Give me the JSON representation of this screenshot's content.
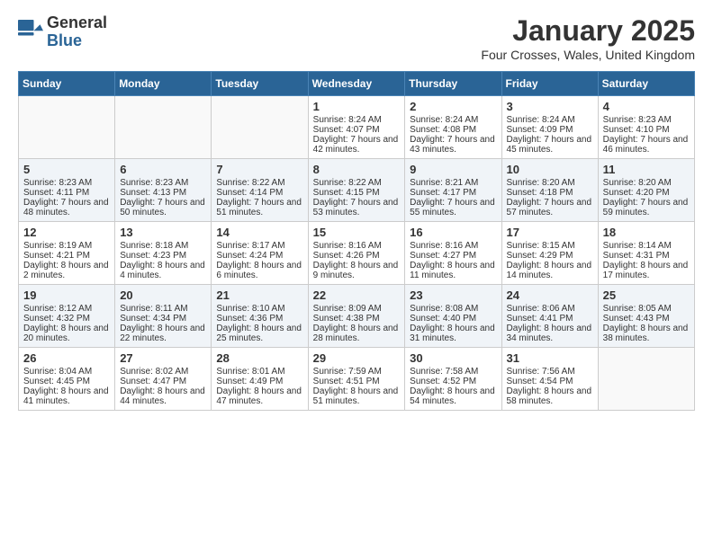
{
  "header": {
    "logo_general": "General",
    "logo_blue": "Blue",
    "month_title": "January 2025",
    "location": "Four Crosses, Wales, United Kingdom"
  },
  "days_of_week": [
    "Sunday",
    "Monday",
    "Tuesday",
    "Wednesday",
    "Thursday",
    "Friday",
    "Saturday"
  ],
  "weeks": [
    [
      {
        "day": "",
        "info": ""
      },
      {
        "day": "",
        "info": ""
      },
      {
        "day": "",
        "info": ""
      },
      {
        "day": "1",
        "info": "Sunrise: 8:24 AM\nSunset: 4:07 PM\nDaylight: 7 hours and 42 minutes."
      },
      {
        "day": "2",
        "info": "Sunrise: 8:24 AM\nSunset: 4:08 PM\nDaylight: 7 hours and 43 minutes."
      },
      {
        "day": "3",
        "info": "Sunrise: 8:24 AM\nSunset: 4:09 PM\nDaylight: 7 hours and 45 minutes."
      },
      {
        "day": "4",
        "info": "Sunrise: 8:23 AM\nSunset: 4:10 PM\nDaylight: 7 hours and 46 minutes."
      }
    ],
    [
      {
        "day": "5",
        "info": "Sunrise: 8:23 AM\nSunset: 4:11 PM\nDaylight: 7 hours and 48 minutes."
      },
      {
        "day": "6",
        "info": "Sunrise: 8:23 AM\nSunset: 4:13 PM\nDaylight: 7 hours and 50 minutes."
      },
      {
        "day": "7",
        "info": "Sunrise: 8:22 AM\nSunset: 4:14 PM\nDaylight: 7 hours and 51 minutes."
      },
      {
        "day": "8",
        "info": "Sunrise: 8:22 AM\nSunset: 4:15 PM\nDaylight: 7 hours and 53 minutes."
      },
      {
        "day": "9",
        "info": "Sunrise: 8:21 AM\nSunset: 4:17 PM\nDaylight: 7 hours and 55 minutes."
      },
      {
        "day": "10",
        "info": "Sunrise: 8:20 AM\nSunset: 4:18 PM\nDaylight: 7 hours and 57 minutes."
      },
      {
        "day": "11",
        "info": "Sunrise: 8:20 AM\nSunset: 4:20 PM\nDaylight: 7 hours and 59 minutes."
      }
    ],
    [
      {
        "day": "12",
        "info": "Sunrise: 8:19 AM\nSunset: 4:21 PM\nDaylight: 8 hours and 2 minutes."
      },
      {
        "day": "13",
        "info": "Sunrise: 8:18 AM\nSunset: 4:23 PM\nDaylight: 8 hours and 4 minutes."
      },
      {
        "day": "14",
        "info": "Sunrise: 8:17 AM\nSunset: 4:24 PM\nDaylight: 8 hours and 6 minutes."
      },
      {
        "day": "15",
        "info": "Sunrise: 8:16 AM\nSunset: 4:26 PM\nDaylight: 8 hours and 9 minutes."
      },
      {
        "day": "16",
        "info": "Sunrise: 8:16 AM\nSunset: 4:27 PM\nDaylight: 8 hours and 11 minutes."
      },
      {
        "day": "17",
        "info": "Sunrise: 8:15 AM\nSunset: 4:29 PM\nDaylight: 8 hours and 14 minutes."
      },
      {
        "day": "18",
        "info": "Sunrise: 8:14 AM\nSunset: 4:31 PM\nDaylight: 8 hours and 17 minutes."
      }
    ],
    [
      {
        "day": "19",
        "info": "Sunrise: 8:12 AM\nSunset: 4:32 PM\nDaylight: 8 hours and 20 minutes."
      },
      {
        "day": "20",
        "info": "Sunrise: 8:11 AM\nSunset: 4:34 PM\nDaylight: 8 hours and 22 minutes."
      },
      {
        "day": "21",
        "info": "Sunrise: 8:10 AM\nSunset: 4:36 PM\nDaylight: 8 hours and 25 minutes."
      },
      {
        "day": "22",
        "info": "Sunrise: 8:09 AM\nSunset: 4:38 PM\nDaylight: 8 hours and 28 minutes."
      },
      {
        "day": "23",
        "info": "Sunrise: 8:08 AM\nSunset: 4:40 PM\nDaylight: 8 hours and 31 minutes."
      },
      {
        "day": "24",
        "info": "Sunrise: 8:06 AM\nSunset: 4:41 PM\nDaylight: 8 hours and 34 minutes."
      },
      {
        "day": "25",
        "info": "Sunrise: 8:05 AM\nSunset: 4:43 PM\nDaylight: 8 hours and 38 minutes."
      }
    ],
    [
      {
        "day": "26",
        "info": "Sunrise: 8:04 AM\nSunset: 4:45 PM\nDaylight: 8 hours and 41 minutes."
      },
      {
        "day": "27",
        "info": "Sunrise: 8:02 AM\nSunset: 4:47 PM\nDaylight: 8 hours and 44 minutes."
      },
      {
        "day": "28",
        "info": "Sunrise: 8:01 AM\nSunset: 4:49 PM\nDaylight: 8 hours and 47 minutes."
      },
      {
        "day": "29",
        "info": "Sunrise: 7:59 AM\nSunset: 4:51 PM\nDaylight: 8 hours and 51 minutes."
      },
      {
        "day": "30",
        "info": "Sunrise: 7:58 AM\nSunset: 4:52 PM\nDaylight: 8 hours and 54 minutes."
      },
      {
        "day": "31",
        "info": "Sunrise: 7:56 AM\nSunset: 4:54 PM\nDaylight: 8 hours and 58 minutes."
      },
      {
        "day": "",
        "info": ""
      }
    ]
  ]
}
